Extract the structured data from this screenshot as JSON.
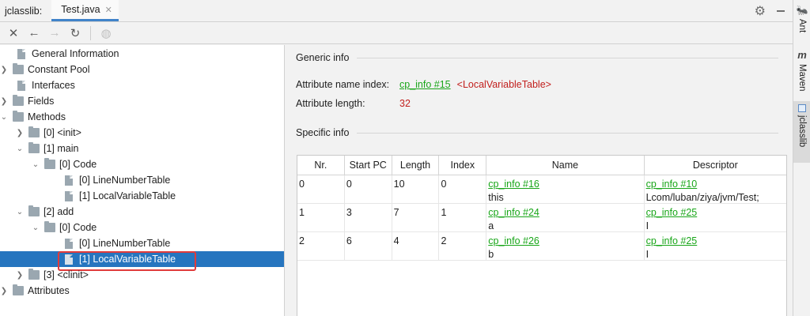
{
  "tabbar": {
    "title": "jclasslib:",
    "tab_label": "Test.java",
    "close_glyph": "✕"
  },
  "toolbar": {
    "buttons": [
      {
        "name": "close",
        "glyph": "✕"
      },
      {
        "name": "back",
        "glyph": "←"
      },
      {
        "name": "forward",
        "glyph": "→"
      },
      {
        "name": "reload",
        "glyph": "↻"
      },
      {
        "name": "browser",
        "glyph": "◍"
      }
    ]
  },
  "tree": {
    "items": [
      {
        "label": "General Information"
      },
      {
        "label": "Constant Pool"
      },
      {
        "label": "Interfaces"
      },
      {
        "label": "Fields"
      },
      {
        "label": "Methods"
      },
      {
        "label": "[0] <init>"
      },
      {
        "label": "[1] main"
      },
      {
        "label": "[0] Code"
      },
      {
        "label": "[0] LineNumberTable"
      },
      {
        "label": "[1] LocalVariableTable"
      },
      {
        "label": "[2] add"
      },
      {
        "label": "[0] Code"
      },
      {
        "label": "[0] LineNumberTable"
      },
      {
        "label": "[1] LocalVariableTable"
      },
      {
        "label": "[3] <clinit>"
      },
      {
        "label": "Attributes"
      }
    ]
  },
  "generic": {
    "title": "Generic info",
    "name_index_label": "Attribute name index:",
    "name_index_link": "cp_info #15",
    "name_index_value": "<LocalVariableTable>",
    "length_label": "Attribute length:",
    "length_value": "32"
  },
  "specific": {
    "title": "Specific info",
    "columns": [
      "Nr.",
      "Start PC",
      "Length",
      "Index",
      "Name",
      "Descriptor"
    ],
    "rows": [
      {
        "nr": "0",
        "start_pc": "0",
        "length": "10",
        "index": "0",
        "name_link": "cp_info #16",
        "name": "this",
        "desc_link": "cp_info #10",
        "desc": "Lcom/luban/ziya/jvm/Test;"
      },
      {
        "nr": "1",
        "start_pc": "3",
        "length": "7",
        "index": "1",
        "name_link": "cp_info #24",
        "name": "a",
        "desc_link": "cp_info #25",
        "desc": "I"
      },
      {
        "nr": "2",
        "start_pc": "6",
        "length": "4",
        "index": "2",
        "name_link": "cp_info #26",
        "name": "b",
        "desc_link": "cp_info #25",
        "desc": "I"
      }
    ]
  },
  "side": {
    "items": [
      {
        "label": "Ant"
      },
      {
        "label": "Maven"
      },
      {
        "label": "jclasslib"
      }
    ]
  },
  "colors": {
    "selection": "#2675bf",
    "link": "#19a619",
    "value_red": "#c2201e",
    "highlight_box": "#e03b3b"
  }
}
